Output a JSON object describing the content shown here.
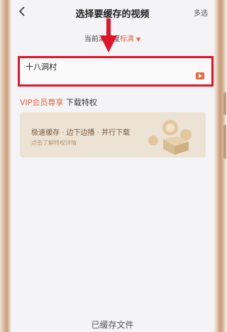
{
  "header": {
    "title": "选择要缓存的视频",
    "multi_select_label": "多选",
    "back_icon": "chevron-left-icon"
  },
  "quality": {
    "prefix": "当前清晰度",
    "value": "标清"
  },
  "videos": [
    {
      "title": "十八洞村"
    }
  ],
  "vip": {
    "vip_label": "VIP会员尊享",
    "privilege_label": "下载特权",
    "card_title": "极速缓存 · 边下边播 · 并行下载",
    "card_subtitle": "点击了解特权详情"
  },
  "bottom": {
    "label": "已缓存文件"
  },
  "colors": {
    "accent": "#e8673e",
    "annotation": "#e0152a"
  }
}
